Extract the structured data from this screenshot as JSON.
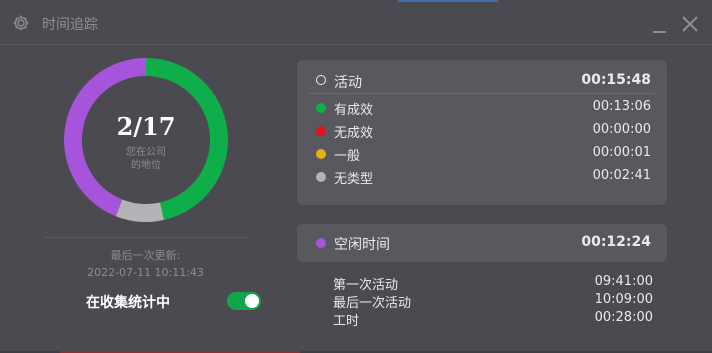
{
  "window": {
    "title": "时间追踪",
    "icons": {
      "settings": "gear-icon",
      "minimize": "minimize-icon",
      "close": "close-icon"
    }
  },
  "summary": {
    "rank": "2/17",
    "rank_label_line1": "您在公司",
    "rank_label_line2": "的地位",
    "last_update_label": "最后一次更新:",
    "last_update_time": "2022-07-11 10:11:43",
    "collecting_label": "在收集统计中",
    "collecting_enabled": true
  },
  "chart_data": {
    "type": "pie",
    "labels": [
      "有成效",
      "无成效",
      "一般",
      "无类型"
    ],
    "values": [
      786,
      0,
      1,
      161
    ],
    "colors": [
      "#0eae4a",
      "#e0141a",
      "#e2b115",
      "#b3b3b5"
    ],
    "style": "donut"
  },
  "activity": {
    "header": {
      "label": "活动",
      "value": "00:15:48"
    },
    "items": [
      {
        "label": "有成效",
        "value": "00:13:06",
        "color": "#0eae4a"
      },
      {
        "label": "无成效",
        "value": "00:00:00",
        "color": "#e0141a"
      },
      {
        "label": "一般",
        "value": "00:00:01",
        "color": "#e2b115"
      },
      {
        "label": "无类型",
        "value": "00:02:41",
        "color": "#b3b3b5"
      }
    ]
  },
  "idle": {
    "label": "空闲时间",
    "value": "00:12:24",
    "color": "#a654dc"
  },
  "stats": [
    {
      "label": "第一次活动",
      "value": "09:41:00"
    },
    {
      "label": "最后一次活动",
      "value": "10:09:00"
    },
    {
      "label": "工时",
      "value": "00:28:00"
    }
  ]
}
